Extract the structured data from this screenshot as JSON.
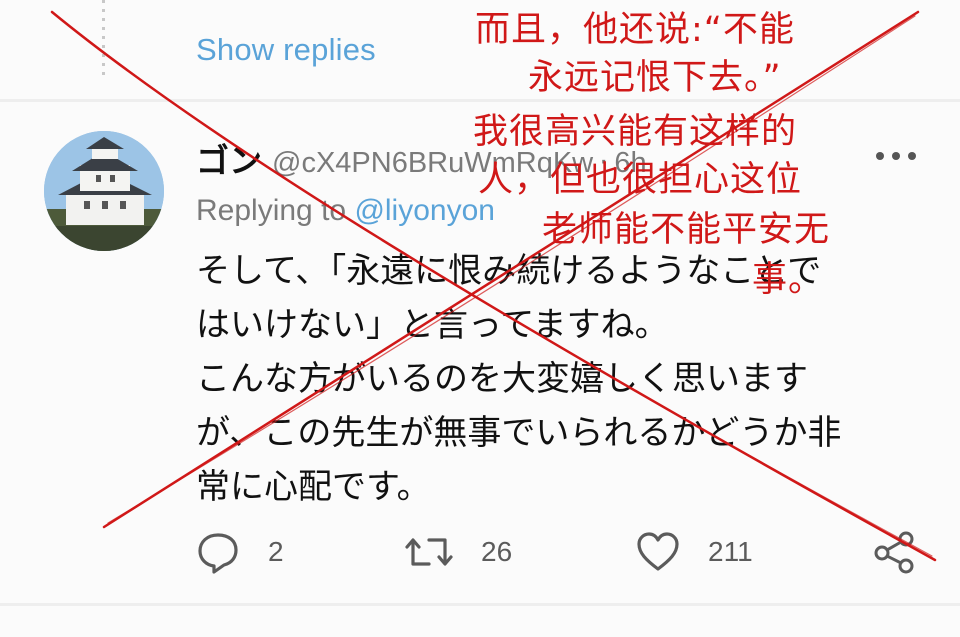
{
  "thread": {
    "show_replies_label": "Show replies"
  },
  "tweet": {
    "display_name": "ゴン",
    "handle": "@cX4PN6BRuWmRqKw",
    "separator": "·",
    "time": "6h",
    "replying_prefix": "Replying to",
    "replying_to": "@liyonyon",
    "text_lines": [
      "そして、「永遠に恨み続けるようなことで",
      "はいけない」と言ってますね。",
      "こんな方がいるのを大変嬉しく思います",
      "が、この先生が無事でいられるかどうか非",
      "常に心配です。"
    ],
    "actions": {
      "reply": {
        "icon": "comment-icon",
        "count": "2"
      },
      "retweet": {
        "icon": "retweet-icon",
        "count": "26"
      },
      "like": {
        "icon": "heart-icon",
        "count": "211"
      },
      "share": {
        "icon": "share-icon"
      }
    }
  },
  "annotation": {
    "color": "#d01818",
    "lines": [
      "而且，他还说:“不能",
      "永远记恨下去。”",
      "我很高兴能有这样的",
      "人，但也很担心这位",
      "老师能不能平安无",
      "事。"
    ]
  },
  "colors": {
    "link": "#5aa3d8",
    "secondary_text": "#7a7a7a",
    "background": "#fbfbfb",
    "annotation_red": "#d01818"
  }
}
